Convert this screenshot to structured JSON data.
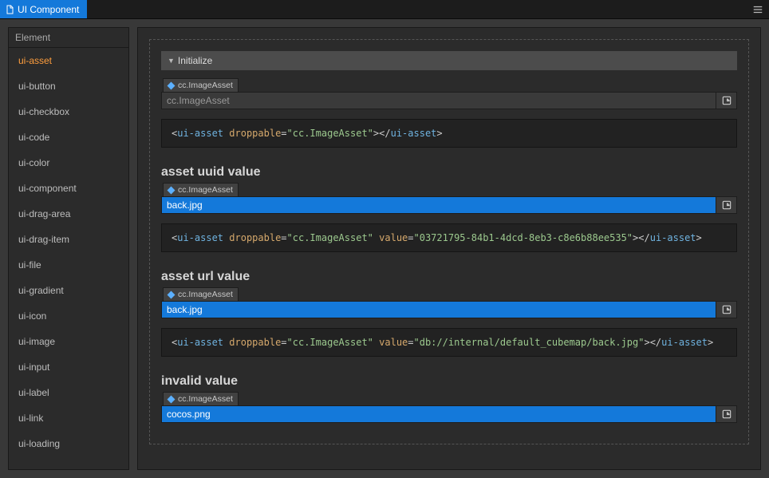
{
  "tab": {
    "title": "UI Component"
  },
  "sidebar": {
    "header": "Element",
    "items": [
      {
        "label": "ui-asset",
        "active": true
      },
      {
        "label": "ui-button"
      },
      {
        "label": "ui-checkbox"
      },
      {
        "label": "ui-code"
      },
      {
        "label": "ui-color"
      },
      {
        "label": "ui-component"
      },
      {
        "label": "ui-drag-area"
      },
      {
        "label": "ui-drag-item"
      },
      {
        "label": "ui-file"
      },
      {
        "label": "ui-gradient"
      },
      {
        "label": "ui-icon"
      },
      {
        "label": "ui-image"
      },
      {
        "label": "ui-input"
      },
      {
        "label": "ui-label"
      },
      {
        "label": "ui-link"
      },
      {
        "label": "ui-loading"
      }
    ]
  },
  "content": {
    "section_header": "Initialize",
    "examples": [
      {
        "title": "",
        "asset_type": "cc.ImageAsset",
        "value": "cc.ImageAsset",
        "filled": false,
        "code_html": "<span class='punct'>&lt;</span><span class='tag'>ui-asset</span> <span class='attr'>droppable</span><span class='punct'>=</span><span class='val'>\"cc.ImageAsset\"</span><span class='punct'>&gt;&lt;/</span><span class='tag'>ui-asset</span><span class='punct'>&gt;</span>"
      },
      {
        "title": "asset uuid value",
        "asset_type": "cc.ImageAsset",
        "value": "back.jpg",
        "filled": true,
        "code_html": "<span class='punct'>&lt;</span><span class='tag'>ui-asset</span> <span class='attr'>droppable</span><span class='punct'>=</span><span class='val'>\"cc.ImageAsset\"</span> <span class='attr'>value</span><span class='punct'>=</span><span class='val'>\"03721795-84b1-4dcd-8eb3-c8e6b88ee535\"</span><span class='punct'>&gt;&lt;/</span><span class='tag'>ui-asset</span><span class='punct'>&gt;</span>"
      },
      {
        "title": "asset url value",
        "asset_type": "cc.ImageAsset",
        "value": "back.jpg",
        "filled": true,
        "code_html": "<span class='punct'>&lt;</span><span class='tag'>ui-asset</span> <span class='attr'>droppable</span><span class='punct'>=</span><span class='val'>\"cc.ImageAsset\"</span> <span class='attr'>value</span><span class='punct'>=</span><span class='val'>\"db://internal/default_cubemap/back.jpg\"</span><span class='punct'>&gt;&lt;/</span><span class='tag'>ui-asset</span><span class='punct'>&gt;</span>"
      },
      {
        "title": "invalid value",
        "asset_type": "cc.ImageAsset",
        "value": "cocos.png",
        "filled": true,
        "code_html": ""
      }
    ]
  }
}
